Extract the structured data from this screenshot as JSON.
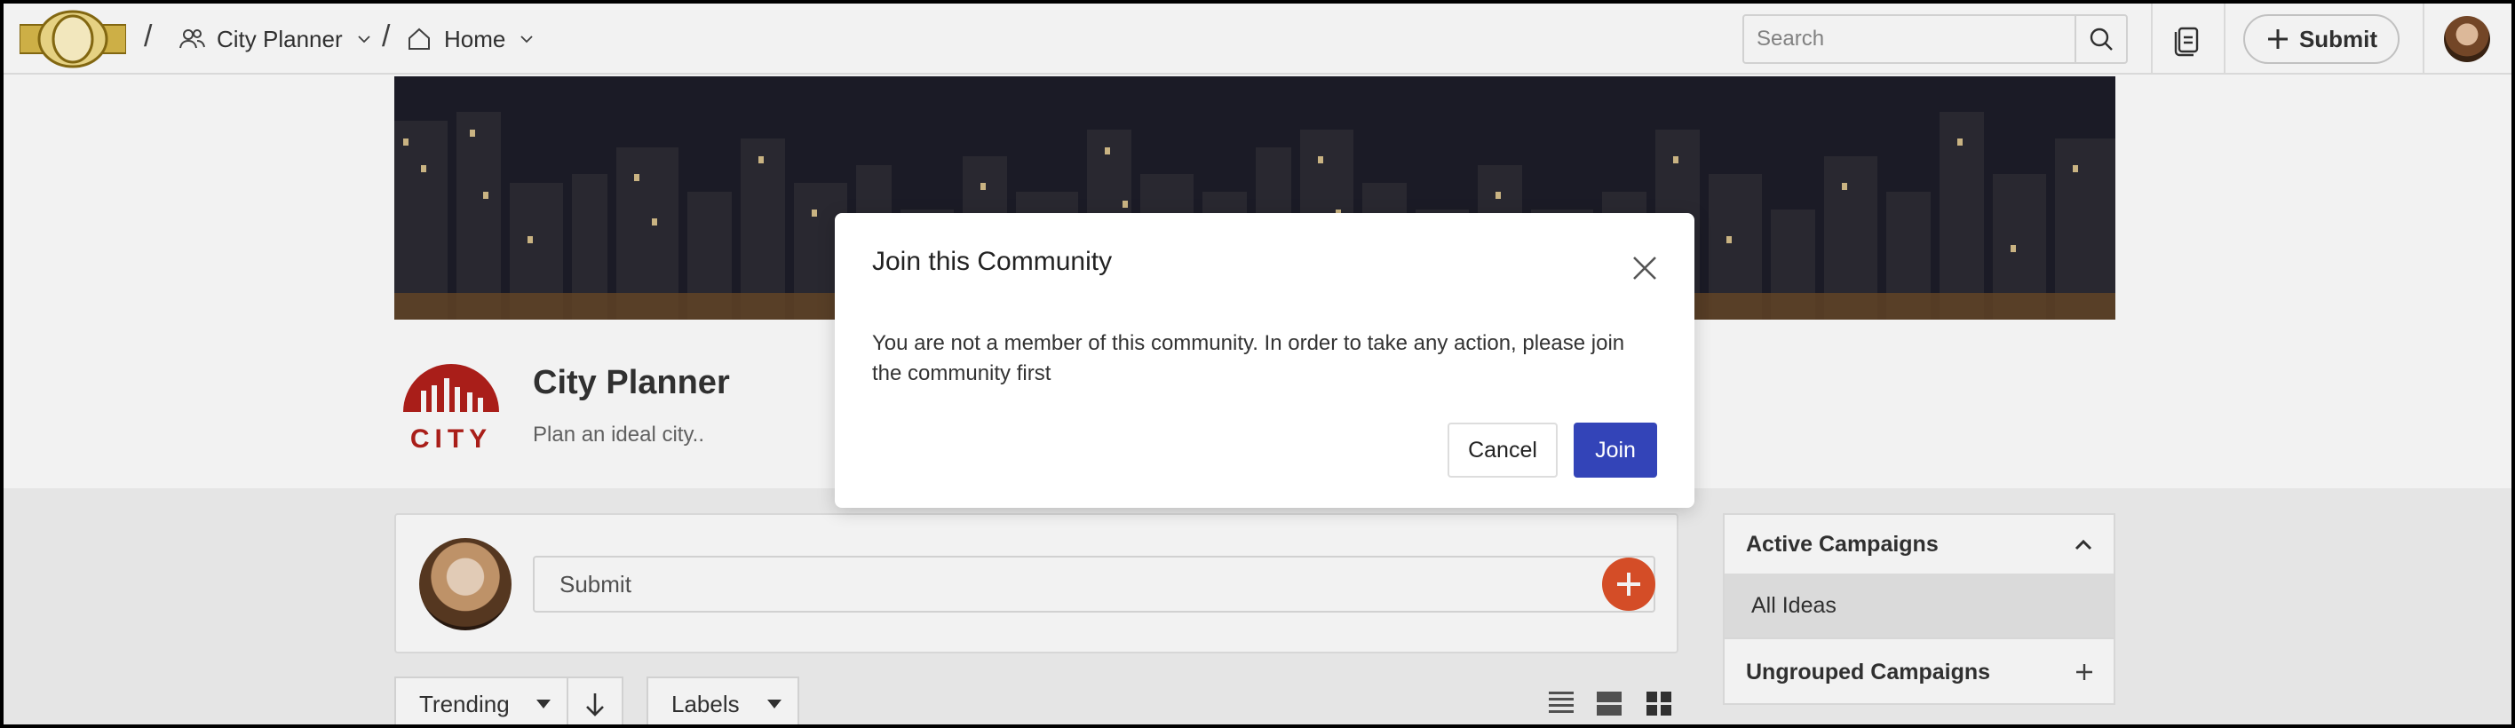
{
  "topbar": {
    "breadcrumb_sep": "/",
    "community_name": "City Planner",
    "home_label": "Home",
    "search_placeholder": "Search",
    "submit_label": "Submit"
  },
  "community": {
    "title": "City Planner",
    "subtitle": "Plan an ideal city..",
    "logo_text": "CITY"
  },
  "submit_card": {
    "field_label": "Submit"
  },
  "toolbar": {
    "sort_label": "Trending",
    "labels_label": "Labels"
  },
  "sidebar": {
    "section_title": "Active Campaigns",
    "selected_item": "All Ideas",
    "group_title": "Ungrouped Campaigns"
  },
  "modal": {
    "title": "Join this Community",
    "body": "You are not a member of this community. In order to take any action, please join the community first",
    "cancel_label": "Cancel",
    "join_label": "Join"
  },
  "colors": {
    "primary": "#3344b8",
    "accent": "#e0522a",
    "logo_red": "#b3201b"
  },
  "icons": [
    "brand-logo",
    "users-icon",
    "chevron-down-icon",
    "home-icon",
    "search-icon",
    "document-icon",
    "plus-icon",
    "close-icon",
    "arrow-down-icon",
    "list-view-icon",
    "compact-view-icon",
    "grid-view-icon",
    "chevron-up-icon"
  ]
}
